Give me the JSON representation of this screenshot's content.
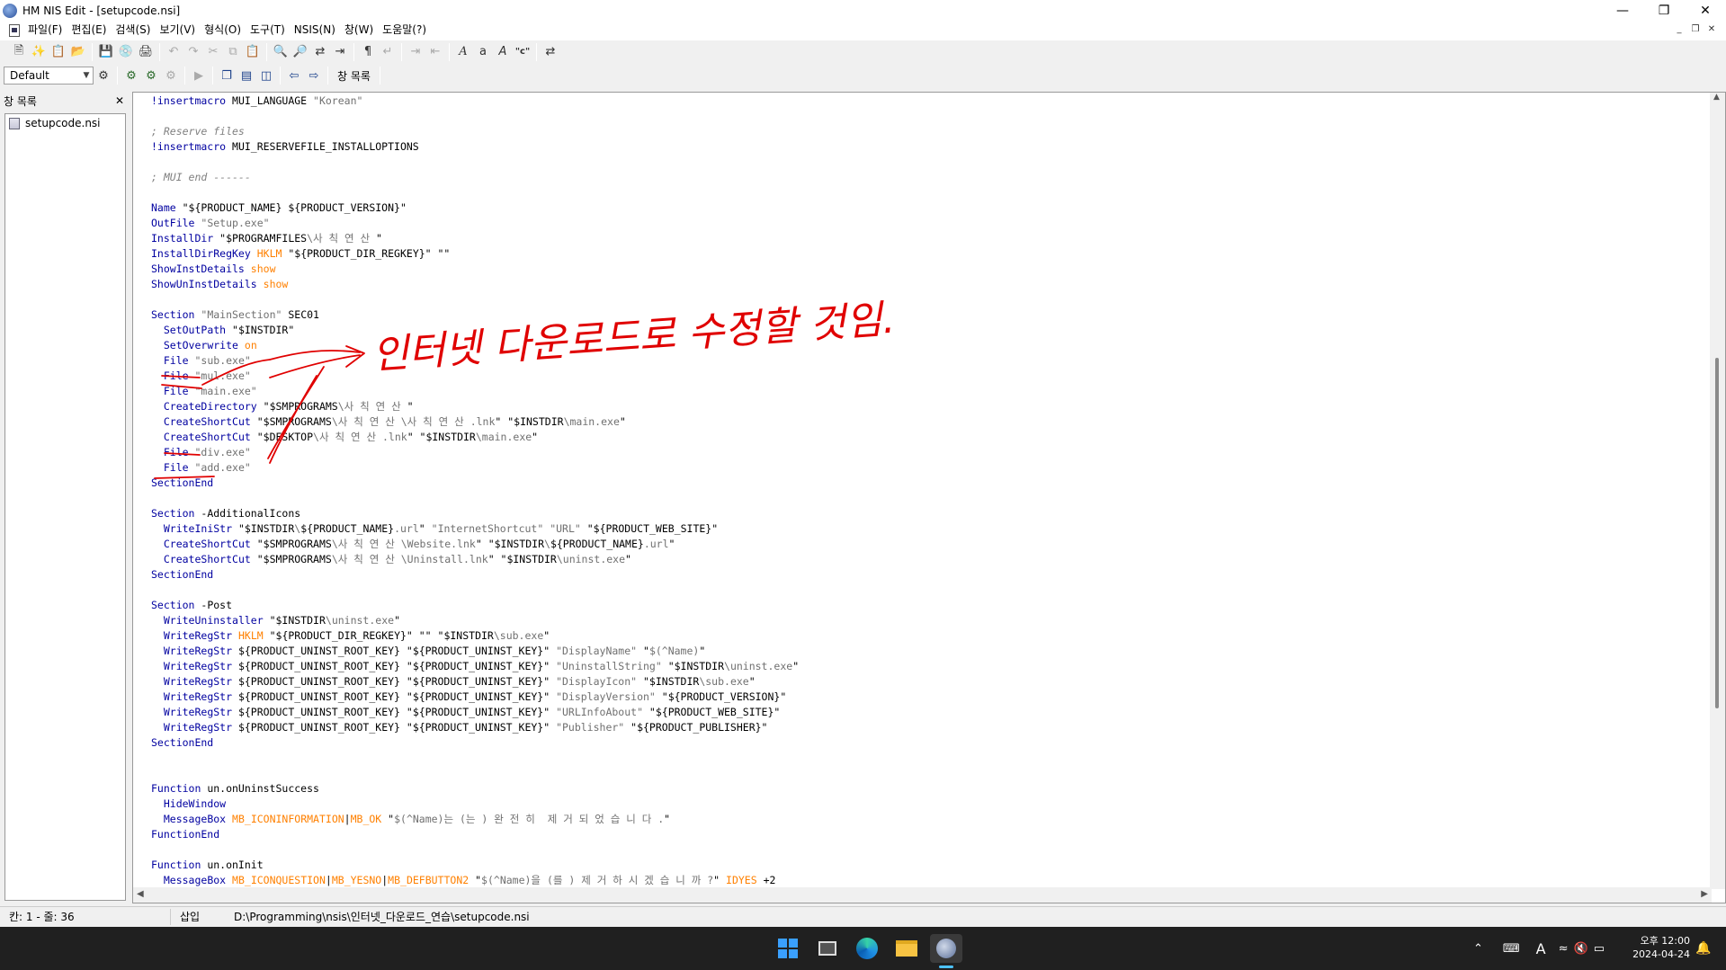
{
  "window": {
    "title": "HM NIS Edit - [setupcode.nsi]"
  },
  "menu": {
    "items": [
      "파일(F)",
      "편집(E)",
      "검색(S)",
      "보기(V)",
      "형식(O)",
      "도구(T)",
      "NSIS(N)",
      "창(W)",
      "도움말(?)"
    ]
  },
  "toolbar2": {
    "combo_value": "Default",
    "window_list_label": "창 목록"
  },
  "sidebar": {
    "title": "창 목록",
    "file": "setupcode.nsi"
  },
  "annotation": {
    "text": "인터넷 다운로드로 수정할 것임."
  },
  "code_lines": [
    [
      [
        "m",
        "!insertmacro"
      ],
      [
        "v",
        " MUI_LANGUAGE "
      ],
      [
        "str",
        "\"Korean\""
      ]
    ],
    [],
    [
      [
        "c",
        "; Reserve files"
      ]
    ],
    [
      [
        "m",
        "!insertmacro"
      ],
      [
        "v",
        " MUI_RESERVEFILE_INSTALLOPTIONS"
      ]
    ],
    [],
    [
      [
        "c",
        "; MUI end ------"
      ]
    ],
    [],
    [
      [
        "k",
        "Name"
      ],
      [
        "v",
        " \"${PRODUCT_NAME} ${PRODUCT_VERSION}\""
      ]
    ],
    [
      [
        "k",
        "OutFile"
      ],
      [
        "v",
        " "
      ],
      [
        "str",
        "\"Setup.exe\""
      ]
    ],
    [
      [
        "k",
        "InstallDir"
      ],
      [
        "v",
        " \"$PROGRAMFILES"
      ],
      [
        "str",
        "\\사 칙 연 산"
      ],
      [
        "v",
        " \""
      ]
    ],
    [
      [
        "k",
        "InstallDirRegKey"
      ],
      [
        "v",
        " "
      ],
      [
        "o",
        "HKLM"
      ],
      [
        "v",
        " \"${PRODUCT_DIR_REGKEY}\" \"\""
      ]
    ],
    [
      [
        "k",
        "ShowInstDetails"
      ],
      [
        "v",
        " "
      ],
      [
        "o",
        "show"
      ]
    ],
    [
      [
        "k",
        "ShowUnInstDetails"
      ],
      [
        "v",
        " "
      ],
      [
        "o",
        "show"
      ]
    ],
    [],
    [
      [
        "k",
        "Section"
      ],
      [
        "v",
        " "
      ],
      [
        "str",
        "\"MainSection\""
      ],
      [
        "v",
        " SEC01"
      ]
    ],
    [
      [
        "v",
        "  "
      ],
      [
        "k",
        "SetOutPath"
      ],
      [
        "v",
        " \"$INSTDIR\""
      ]
    ],
    [
      [
        "v",
        "  "
      ],
      [
        "k",
        "SetOverwrite"
      ],
      [
        "v",
        " "
      ],
      [
        "o",
        "on"
      ]
    ],
    [
      [
        "v",
        "  "
      ],
      [
        "k",
        "File"
      ],
      [
        "v",
        " "
      ],
      [
        "str",
        "\"sub.exe\""
      ]
    ],
    [
      [
        "v",
        "  "
      ],
      [
        "k",
        "File"
      ],
      [
        "v",
        " "
      ],
      [
        "str",
        "\"mul.exe\""
      ]
    ],
    [
      [
        "v",
        "  "
      ],
      [
        "k",
        "File"
      ],
      [
        "v",
        " "
      ],
      [
        "str",
        "\"main.exe\""
      ]
    ],
    [
      [
        "v",
        "  "
      ],
      [
        "k",
        "CreateDirectory"
      ],
      [
        "v",
        " \"$SMPROGRAMS"
      ],
      [
        "str",
        "\\사 칙 연 산"
      ],
      [
        "v",
        " \""
      ]
    ],
    [
      [
        "v",
        "  "
      ],
      [
        "k",
        "CreateShortCut"
      ],
      [
        "v",
        " \"$SMPROGRAMS"
      ],
      [
        "str",
        "\\사 칙 연 산 \\사 칙 연 산 .lnk"
      ],
      [
        "v",
        "\" \"$INSTDIR"
      ],
      [
        "str",
        "\\main.exe"
      ],
      [
        "v",
        "\""
      ]
    ],
    [
      [
        "v",
        "  "
      ],
      [
        "k",
        "CreateShortCut"
      ],
      [
        "v",
        " \"$DESKTOP"
      ],
      [
        "str",
        "\\사 칙 연 산 .lnk"
      ],
      [
        "v",
        "\" \"$INSTDIR"
      ],
      [
        "str",
        "\\main.exe"
      ],
      [
        "v",
        "\""
      ]
    ],
    [
      [
        "v",
        "  "
      ],
      [
        "k",
        "File"
      ],
      [
        "v",
        " "
      ],
      [
        "str",
        "\"div.exe\""
      ]
    ],
    [
      [
        "v",
        "  "
      ],
      [
        "k",
        "File"
      ],
      [
        "v",
        " "
      ],
      [
        "str",
        "\"add.exe\""
      ]
    ],
    [
      [
        "k",
        "SectionEnd"
      ]
    ],
    [],
    [
      [
        "k",
        "Section"
      ],
      [
        "v",
        " -AdditionalIcons"
      ]
    ],
    [
      [
        "v",
        "  "
      ],
      [
        "k",
        "WriteIniStr"
      ],
      [
        "v",
        " \"$INSTDIR"
      ],
      [
        "str",
        "\\"
      ],
      [
        "v",
        "${PRODUCT_NAME}"
      ],
      [
        "str",
        ".url"
      ],
      [
        "v",
        "\" "
      ],
      [
        "str",
        "\"InternetShortcut\""
      ],
      [
        "v",
        " "
      ],
      [
        "str",
        "\"URL\""
      ],
      [
        "v",
        " \"${PRODUCT_WEB_SITE}\""
      ]
    ],
    [
      [
        "v",
        "  "
      ],
      [
        "k",
        "CreateShortCut"
      ],
      [
        "v",
        " \"$SMPROGRAMS"
      ],
      [
        "str",
        "\\사 칙 연 산 \\Website.lnk"
      ],
      [
        "v",
        "\" \"$INSTDIR"
      ],
      [
        "str",
        "\\"
      ],
      [
        "v",
        "${PRODUCT_NAME}"
      ],
      [
        "str",
        ".url"
      ],
      [
        "v",
        "\""
      ]
    ],
    [
      [
        "v",
        "  "
      ],
      [
        "k",
        "CreateShortCut"
      ],
      [
        "v",
        " \"$SMPROGRAMS"
      ],
      [
        "str",
        "\\사 칙 연 산 \\Uninstall.lnk"
      ],
      [
        "v",
        "\" \"$INSTDIR"
      ],
      [
        "str",
        "\\uninst.exe"
      ],
      [
        "v",
        "\""
      ]
    ],
    [
      [
        "k",
        "SectionEnd"
      ]
    ],
    [],
    [
      [
        "k",
        "Section"
      ],
      [
        "v",
        " -Post"
      ]
    ],
    [
      [
        "v",
        "  "
      ],
      [
        "k",
        "WriteUninstaller"
      ],
      [
        "v",
        " \"$INSTDIR"
      ],
      [
        "str",
        "\\uninst.exe"
      ],
      [
        "v",
        "\""
      ]
    ],
    [
      [
        "v",
        "  "
      ],
      [
        "k",
        "WriteRegStr"
      ],
      [
        "v",
        " "
      ],
      [
        "o",
        "HKLM"
      ],
      [
        "v",
        " \"${PRODUCT_DIR_REGKEY}\" \"\" \"$INSTDIR"
      ],
      [
        "str",
        "\\sub.exe"
      ],
      [
        "v",
        "\""
      ]
    ],
    [
      [
        "v",
        "  "
      ],
      [
        "k",
        "WriteRegStr"
      ],
      [
        "v",
        " ${PRODUCT_UNINST_ROOT_KEY} \"${PRODUCT_UNINST_KEY}\" "
      ],
      [
        "str",
        "\"DisplayName\""
      ],
      [
        "v",
        " \""
      ],
      [
        "str",
        "$(^Name)"
      ],
      [
        "v",
        "\""
      ]
    ],
    [
      [
        "v",
        "  "
      ],
      [
        "k",
        "WriteRegStr"
      ],
      [
        "v",
        " ${PRODUCT_UNINST_ROOT_KEY} \"${PRODUCT_UNINST_KEY}\" "
      ],
      [
        "str",
        "\"UninstallString\""
      ],
      [
        "v",
        " \"$INSTDIR"
      ],
      [
        "str",
        "\\uninst.exe"
      ],
      [
        "v",
        "\""
      ]
    ],
    [
      [
        "v",
        "  "
      ],
      [
        "k",
        "WriteRegStr"
      ],
      [
        "v",
        " ${PRODUCT_UNINST_ROOT_KEY} \"${PRODUCT_UNINST_KEY}\" "
      ],
      [
        "str",
        "\"DisplayIcon\""
      ],
      [
        "v",
        " \"$INSTDIR"
      ],
      [
        "str",
        "\\sub.exe"
      ],
      [
        "v",
        "\""
      ]
    ],
    [
      [
        "v",
        "  "
      ],
      [
        "k",
        "WriteRegStr"
      ],
      [
        "v",
        " ${PRODUCT_UNINST_ROOT_KEY} \"${PRODUCT_UNINST_KEY}\" "
      ],
      [
        "str",
        "\"DisplayVersion\""
      ],
      [
        "v",
        " \"${PRODUCT_VERSION}\""
      ]
    ],
    [
      [
        "v",
        "  "
      ],
      [
        "k",
        "WriteRegStr"
      ],
      [
        "v",
        " ${PRODUCT_UNINST_ROOT_KEY} \"${PRODUCT_UNINST_KEY}\" "
      ],
      [
        "str",
        "\"URLInfoAbout\""
      ],
      [
        "v",
        " \"${PRODUCT_WEB_SITE}\""
      ]
    ],
    [
      [
        "v",
        "  "
      ],
      [
        "k",
        "WriteRegStr"
      ],
      [
        "v",
        " ${PRODUCT_UNINST_ROOT_KEY} \"${PRODUCT_UNINST_KEY}\" "
      ],
      [
        "str",
        "\"Publisher\""
      ],
      [
        "v",
        " \"${PRODUCT_PUBLISHER}\""
      ]
    ],
    [
      [
        "k",
        "SectionEnd"
      ]
    ],
    [],
    [],
    [
      [
        "k",
        "Function"
      ],
      [
        "v",
        " un.onUninstSuccess"
      ]
    ],
    [
      [
        "v",
        "  "
      ],
      [
        "k",
        "HideWindow"
      ]
    ],
    [
      [
        "v",
        "  "
      ],
      [
        "k",
        "MessageBox"
      ],
      [
        "v",
        " "
      ],
      [
        "o",
        "MB_ICONINFORMATION"
      ],
      [
        "v",
        "|"
      ],
      [
        "o",
        "MB_OK"
      ],
      [
        "v",
        " \""
      ],
      [
        "str",
        "$(^Name)는 (는 ) 완 전 히  제 거 되 었 습 니 다 ."
      ],
      [
        "v",
        "\""
      ]
    ],
    [
      [
        "k",
        "FunctionEnd"
      ]
    ],
    [],
    [
      [
        "k",
        "Function"
      ],
      [
        "v",
        " un.onInit"
      ]
    ],
    [
      [
        "v",
        "  "
      ],
      [
        "k",
        "MessageBox"
      ],
      [
        "v",
        " "
      ],
      [
        "o",
        "MB_ICONQUESTION"
      ],
      [
        "v",
        "|"
      ],
      [
        "o",
        "MB_YESNO"
      ],
      [
        "v",
        "|"
      ],
      [
        "o",
        "MB_DEFBUTTON2"
      ],
      [
        "v",
        " \""
      ],
      [
        "str",
        "$(^Name)을 (를 ) 제 거 하 시 겠 습 니 까 ?"
      ],
      [
        "v",
        "\" "
      ],
      [
        "o",
        "IDYES"
      ],
      [
        "v",
        " +2"
      ]
    ]
  ],
  "statusbar": {
    "position": "칸: 1 - 줄: 36",
    "mode": "삽입",
    "path": "D:\\Programming\\nsis\\인터넷_다운로드_연습\\setupcode.nsi"
  },
  "clock": {
    "time": "오후 12:00",
    "date": "2024-04-24"
  },
  "colors": {
    "keyword": "#0000a0",
    "string": "#707070",
    "option": "#ff8000",
    "comment": "#808080",
    "annotation": "#e00000"
  }
}
